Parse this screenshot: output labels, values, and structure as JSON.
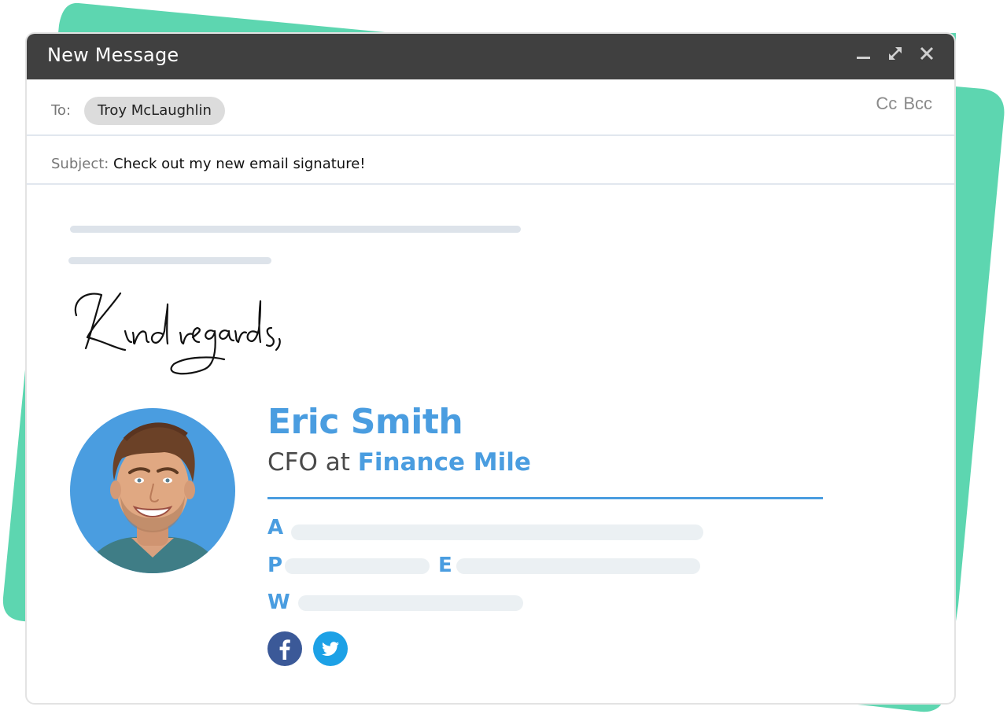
{
  "colors": {
    "background_shape": "#5dd6b0",
    "titlebar": "#404040",
    "accent": "#4a9de0",
    "facebook": "#3b5998",
    "twitter": "#1da1e6",
    "placeholder": "#dde3ea"
  },
  "window": {
    "title": "New Message",
    "controls": [
      {
        "name": "minimize",
        "icon": "minimize-icon"
      },
      {
        "name": "expand",
        "icon": "expand-icon"
      },
      {
        "name": "close",
        "icon": "close-icon"
      }
    ]
  },
  "compose": {
    "to_label": "To:",
    "recipient": "Troy McLaughlin",
    "cc_label": "Cc",
    "bcc_label": "Bcc",
    "subject_label": "Subject:",
    "subject_value": "Check out my new email signature!"
  },
  "body": {
    "closing": "Kind regards,"
  },
  "signature": {
    "name": "Eric Smith",
    "role_prefix": "CFO at",
    "company": "Finance Mile",
    "fields": [
      {
        "letter": "A",
        "meaning": "address"
      },
      {
        "letter": "P",
        "meaning": "phone"
      },
      {
        "letter": "E",
        "meaning": "email"
      },
      {
        "letter": "W",
        "meaning": "website"
      }
    ],
    "social": [
      {
        "name": "facebook",
        "icon": "facebook-icon"
      },
      {
        "name": "twitter",
        "icon": "twitter-icon"
      }
    ]
  }
}
